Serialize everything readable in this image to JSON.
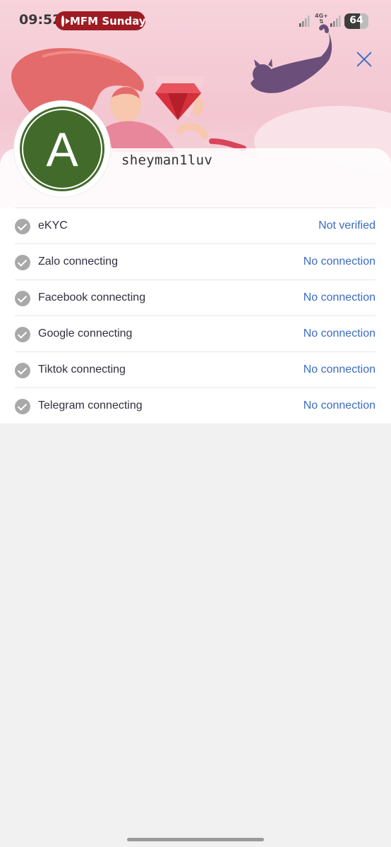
{
  "status_bar": {
    "time": "09:52",
    "media_text": "MFM Sunday",
    "network_type": "4G+",
    "battery": "64",
    "battery_level": 0.64
  },
  "profile": {
    "avatar_letter": "A",
    "avatar_color": "#426b2b",
    "username": "sheyman1luv"
  },
  "connections": [
    {
      "label": "eKYC",
      "status": "Not verified"
    },
    {
      "label": "Zalo connecting",
      "status": "No connection"
    },
    {
      "label": "Facebook connecting",
      "status": "No connection"
    },
    {
      "label": "Google connecting",
      "status": "No connection"
    },
    {
      "label": "Tiktok connecting",
      "status": "No connection"
    },
    {
      "label": "Telegram connecting",
      "status": "No connection"
    }
  ],
  "colors": {
    "accent": "#3b6cc2",
    "header_bg": "#f3c6d1",
    "media_pill": "#9e1b22"
  }
}
